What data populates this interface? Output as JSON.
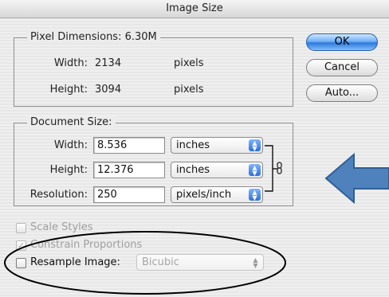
{
  "window": {
    "title": "Image Size"
  },
  "pixel_dimensions": {
    "legend": "Pixel Dimensions:  6.30M",
    "width_label": "Width:",
    "width_value": "2134",
    "width_unit": "pixels",
    "height_label": "Height:",
    "height_value": "3094",
    "height_unit": "pixels"
  },
  "document_size": {
    "legend": "Document Size:",
    "width_label": "Width:",
    "width_value": "8.536",
    "width_unit": "inches",
    "height_label": "Height:",
    "height_value": "12.376",
    "height_unit": "inches",
    "resolution_label": "Resolution:",
    "resolution_value": "250",
    "resolution_unit": "pixels/inch",
    "link_icon": "chain-link-icon"
  },
  "options": {
    "scale_styles": {
      "label": "Scale Styles",
      "checked": false
    },
    "constrain_proportions": {
      "label": "Constrain Proportions",
      "checked": true
    },
    "resample_image": {
      "label": "Resample Image:",
      "checked": false,
      "method": "Bicubic"
    }
  },
  "buttons": {
    "ok": "OK",
    "cancel": "Cancel",
    "auto": "Auto..."
  },
  "colors": {
    "annotation_arrow": "#4f81bd",
    "default_button": "#3a82e0"
  }
}
